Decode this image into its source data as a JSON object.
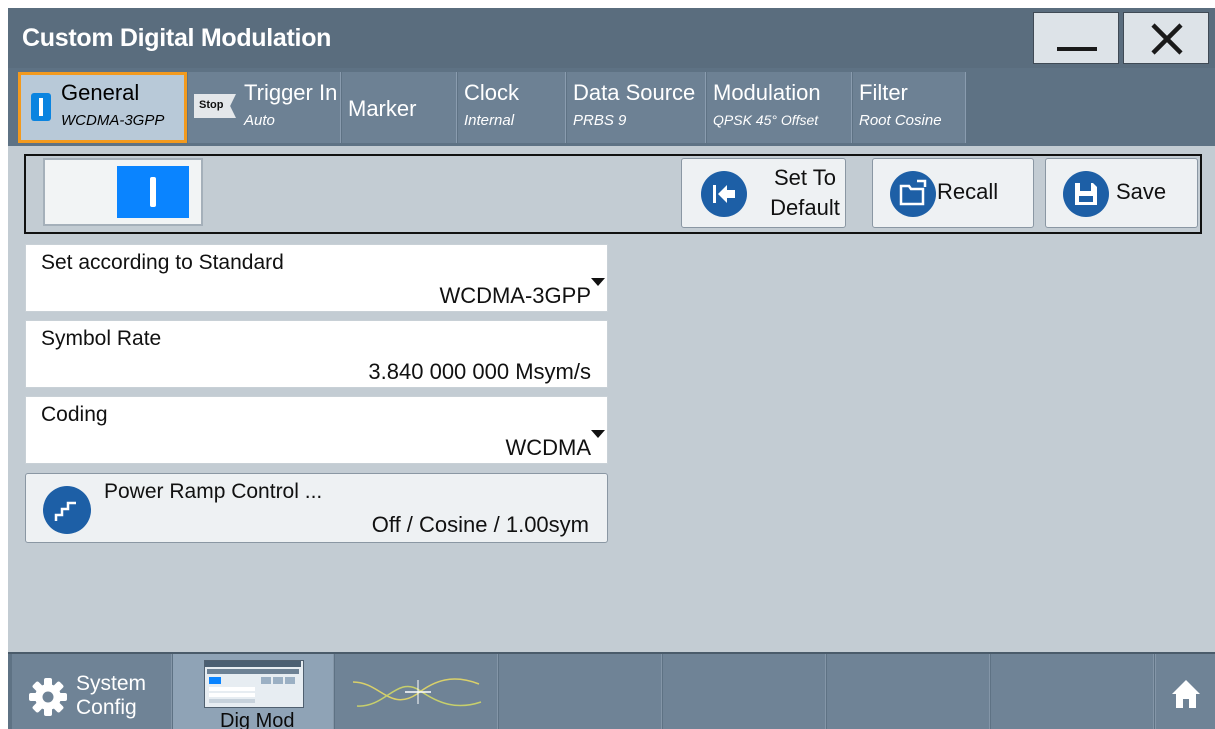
{
  "window": {
    "title": "Custom Digital Modulation",
    "minimize_icon": "minimize-icon",
    "close_icon": "close-icon"
  },
  "tabs": [
    {
      "label": "General",
      "sub": "WCDMA-3GPP",
      "icon": "state-on-icon",
      "active": true
    },
    {
      "label": "Trigger In",
      "sub": "Auto",
      "badge": "Stop"
    },
    {
      "label": "Marker",
      "sub": ""
    },
    {
      "label": "Clock",
      "sub": "Internal"
    },
    {
      "label": "Data Source",
      "sub": "PRBS 9"
    },
    {
      "label": "Modulation",
      "sub": "QPSK 45° Offset"
    },
    {
      "label": "Filter",
      "sub": "Root Cosine"
    }
  ],
  "toolbar": {
    "state_toggle": {
      "on": true,
      "icon": "power-on-icon"
    },
    "set_default_line1": "Set To",
    "set_default_line2": "Default",
    "recall_label": "Recall",
    "save_label": "Save"
  },
  "fields": {
    "standard": {
      "label": "Set according to Standard",
      "value": "WCDMA-3GPP"
    },
    "symbol_rate": {
      "label": "Symbol Rate",
      "value": "3.840 000 000 Msym/s"
    },
    "coding": {
      "label": "Coding",
      "value": "WCDMA"
    },
    "power_ramp": {
      "label": "Power Ramp Control ...",
      "value": "Off / Cosine / 1.00sym",
      "icon": "ramp-icon"
    }
  },
  "taskbar": {
    "system_config_line1": "System",
    "system_config_line2": "Config",
    "dig_mod_label": "Dig Mod",
    "home_icon": "home-icon"
  },
  "colors": {
    "accent": "#0a84ff",
    "active_tab_border": "#f39a1e",
    "button_circle": "#1d5fa6",
    "title_bar": "#5a6d7e"
  }
}
